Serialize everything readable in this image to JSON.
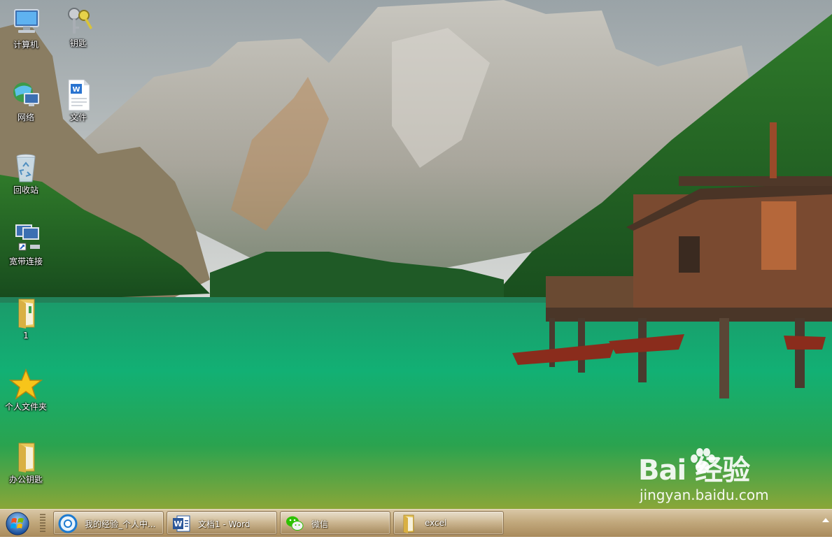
{
  "desktop": {
    "icons": [
      {
        "label": "计算机",
        "icon": "computer-icon"
      },
      {
        "label": "钥匙",
        "icon": "keys-icon"
      },
      {
        "label": "网络",
        "icon": "network-icon"
      },
      {
        "label": "文件",
        "icon": "word-document-icon"
      },
      {
        "label": "回收站",
        "icon": "recycle-bin-icon"
      },
      {
        "label": "宽带连接",
        "icon": "broadband-connection-icon"
      },
      {
        "label": "1",
        "icon": "folder-icon"
      },
      {
        "label": "个人文件夹",
        "icon": "star-icon"
      },
      {
        "label": "办公钥匙",
        "icon": "folder-icon"
      }
    ]
  },
  "taskbar": {
    "start_icon": "windows-start-icon",
    "buttons": [
      {
        "label": "我的经验_个人中...",
        "icon": "browser-icon"
      },
      {
        "label": "文档1 - Word",
        "icon": "word-icon"
      },
      {
        "label": "微信",
        "icon": "wechat-icon"
      },
      {
        "label": "excel",
        "icon": "folder-icon"
      }
    ],
    "tray_icon": "show-hidden-icons-arrow"
  },
  "watermark": {
    "brand": "Bai 经验",
    "url": "jingyan.baidu.com"
  },
  "colors": {
    "taskbar": "#b89a6a",
    "lake": "#1ea86b",
    "desktop_label": "#ffffff"
  }
}
